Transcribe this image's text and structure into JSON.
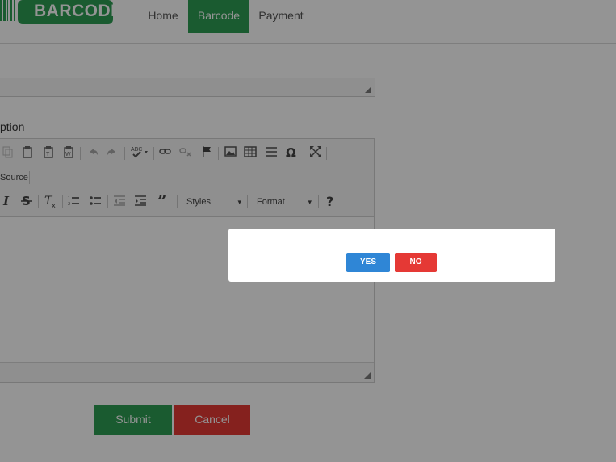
{
  "app": {
    "logo_text": "BARCODE"
  },
  "nav": {
    "items": [
      {
        "label": "Home"
      },
      {
        "label": "Barcode"
      },
      {
        "label": "Payment"
      }
    ],
    "active_color": "#2e9e54"
  },
  "form": {
    "description_label": "ption",
    "toolbar": {
      "source_label": "Source",
      "styles_label": "Styles",
      "format_label": "Format"
    },
    "submit_label": "Submit",
    "cancel_label": "Cancel"
  },
  "dialog": {
    "yes_label": "YES",
    "no_label": "NO"
  },
  "colors": {
    "green": "#2e9e54",
    "red": "#e53935",
    "blue": "#2f86d6"
  }
}
